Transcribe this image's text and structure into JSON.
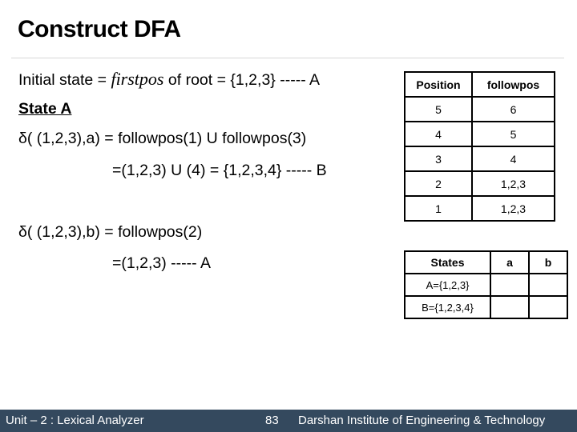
{
  "slide": {
    "title": "Construct DFA",
    "lines": {
      "initial_prefix": "Initial state = ",
      "initial_italic": "firstpos",
      "initial_suffix": " of root = {1,2,3} ----- A",
      "state_heading": "State A",
      "delta_a": "δ( (1,2,3),a) = followpos(1) U followpos(3)",
      "delta_a_result": "=(1,2,3) U (4) = {1,2,3,4} ----- B",
      "delta_b": "δ( (1,2,3),b) = followpos(2)",
      "delta_b_result": "=(1,2,3) ----- A"
    }
  },
  "followpos_table": {
    "headers": [
      "Position",
      "followpos"
    ],
    "rows": [
      [
        "5",
        "6"
      ],
      [
        "4",
        "5"
      ],
      [
        "3",
        "4"
      ],
      [
        "2",
        "1,2,3"
      ],
      [
        "1",
        "1,2,3"
      ]
    ]
  },
  "dtran_table": {
    "headers": [
      "States",
      "a",
      "b"
    ],
    "rows": [
      [
        "A={1,2,3}",
        "",
        ""
      ],
      [
        "B={1,2,3,4}",
        "",
        ""
      ]
    ]
  },
  "footer": {
    "unit": "Unit – 2 : Lexical Analyzer",
    "page": "83",
    "institute": "Darshan Institute of Engineering & Technology",
    "bg_color": "#34495e"
  }
}
